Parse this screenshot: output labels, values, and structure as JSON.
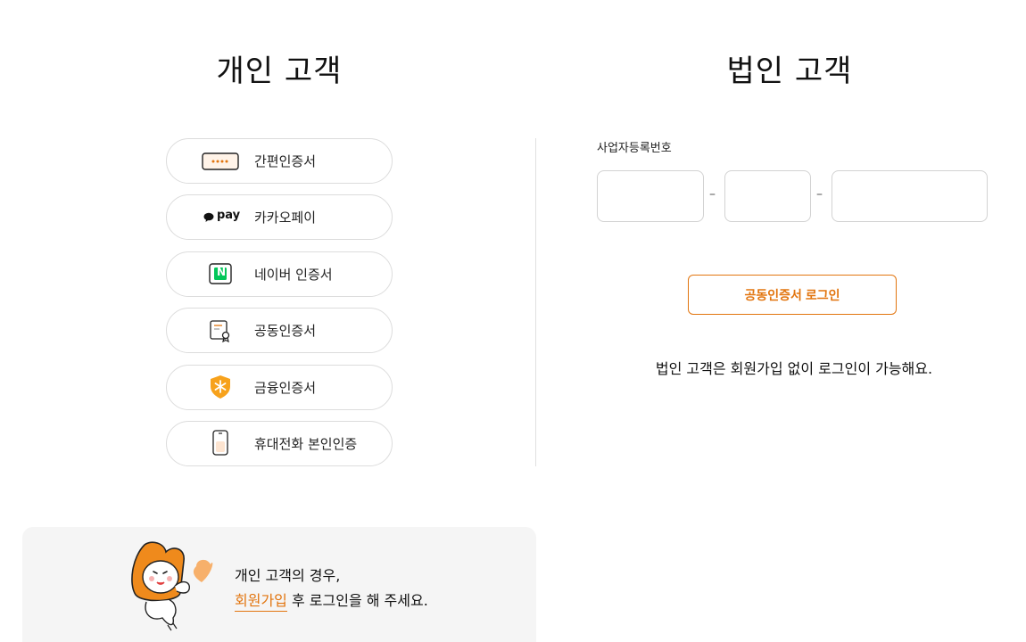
{
  "personal": {
    "title": "개인 고객",
    "auth_methods": [
      {
        "label": "간편인증서",
        "icon": "simple-cert-icon"
      },
      {
        "label": "카카오페이",
        "icon": "kakaopay-icon",
        "icon_text": "pay"
      },
      {
        "label": "네이버 인증서",
        "icon": "naver-icon",
        "icon_text": "N"
      },
      {
        "label": "공동인증서",
        "icon": "joint-cert-icon"
      },
      {
        "label": "금융인증서",
        "icon": "financial-cert-icon"
      },
      {
        "label": "휴대전화 본인인증",
        "icon": "mobile-phone-icon"
      }
    ],
    "info": {
      "line1": "개인 고객의 경우,",
      "join_link": "회원가입",
      "line2_rest": " 후 로그인을 해 주세요."
    }
  },
  "corporate": {
    "title": "법인 고객",
    "biz_number_label": "사업자등록번호",
    "dash": "–",
    "fields": [
      {
        "value": "",
        "placeholder": ""
      },
      {
        "value": "",
        "placeholder": ""
      },
      {
        "value": "",
        "placeholder": ""
      }
    ],
    "login_button": "공동인증서 로그인",
    "note": "법인 고객은 회원가입 없이 로그인이 가능해요."
  },
  "colors": {
    "accent": "#e2750f",
    "naver_green": "#03c75a",
    "border": "#dcdcdc",
    "info_bg": "#f5f5f5"
  }
}
